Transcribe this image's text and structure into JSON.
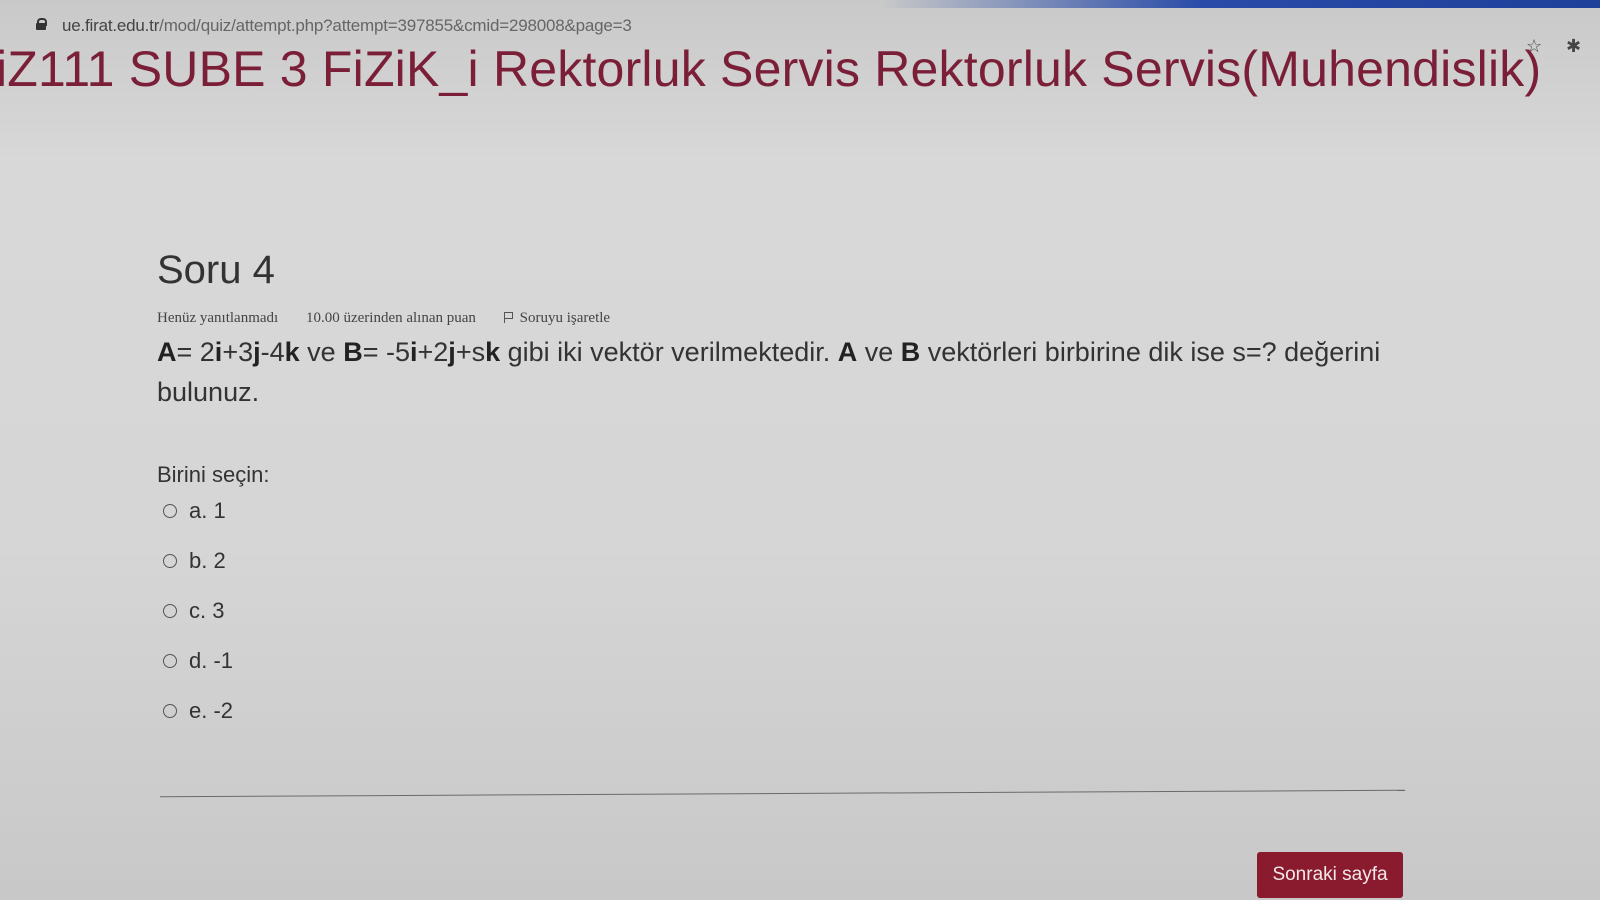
{
  "browser": {
    "url_host": "ue.firat.edu.tr",
    "url_path": "/mod/quiz/attempt.php?attempt=397855&cmid=298008&page=3",
    "icons": [
      "lock-icon",
      "star-icon",
      "extensions-icon"
    ]
  },
  "course": {
    "title": "iZ111 SUBE 3 FiZiK_i Rektorluk Servis Rektorluk Servis(Muhendislik)"
  },
  "question": {
    "heading": "Soru 4",
    "status": "Henüz yanıtlanmadı",
    "points": "10.00 üzerinden alınan puan",
    "flag_label": "Soruyu işaretle",
    "text": {
      "a_label": "A",
      "a_expr_1": "= 2",
      "i1": "i",
      "a_expr_2": "+3",
      "j1": "j",
      "a_expr_3": "-4",
      "k1": "k",
      "ve1": " ve ",
      "b_label": "B",
      "b_expr_1": "= -5",
      "i2": "i",
      "b_expr_2": "+2",
      "j2": "j",
      "b_expr_3": "+s",
      "k2": "k",
      "mid": " gibi iki vektör verilmektedir. ",
      "a_label_2": "A",
      "ve2": " ve ",
      "b_label_2": "B",
      "end": " vektörleri birbirine dik ise s=? değerini bulunuz."
    },
    "prompt": "Birini seçin:",
    "options": [
      "a. 1",
      "b. 2",
      "c. 3",
      "d. -1",
      "e. -2"
    ]
  },
  "navigation": {
    "next_label": "Sonraki sayfa"
  },
  "colors": {
    "accent": "#7a1f37",
    "button": "#8a1a2e"
  }
}
